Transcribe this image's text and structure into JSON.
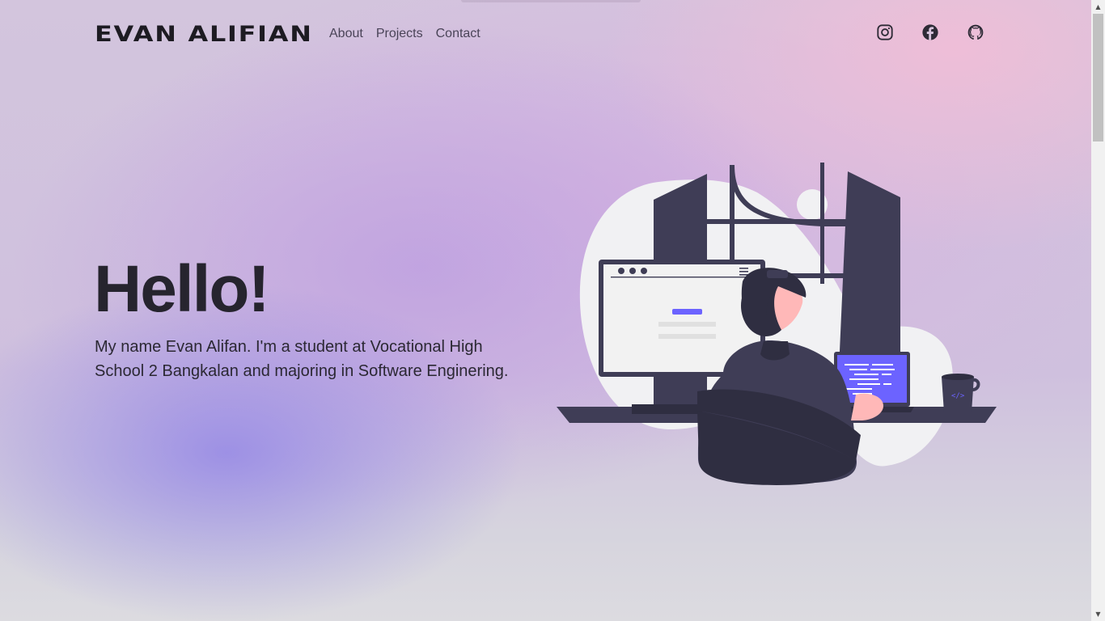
{
  "header": {
    "logo": "EVAN ALIFIAN",
    "nav": [
      {
        "label": "About"
      },
      {
        "label": "Projects"
      },
      {
        "label": "Contact"
      }
    ],
    "socials": [
      {
        "icon": "instagram-icon"
      },
      {
        "icon": "facebook-icon"
      },
      {
        "icon": "github-icon"
      }
    ]
  },
  "hero": {
    "title": "Hello!",
    "description": "My name Evan Alifan. I'm a student at Vocational High School 2 Bangkalan and majoring in Software Enginering."
  },
  "illustration": {
    "subject": "developer-working-at-desk"
  },
  "colors": {
    "text_dark": "#26242e",
    "nav_text": "#4a4458",
    "accent_purple": "#6c63ff",
    "illustration_dark": "#3f3d56"
  }
}
